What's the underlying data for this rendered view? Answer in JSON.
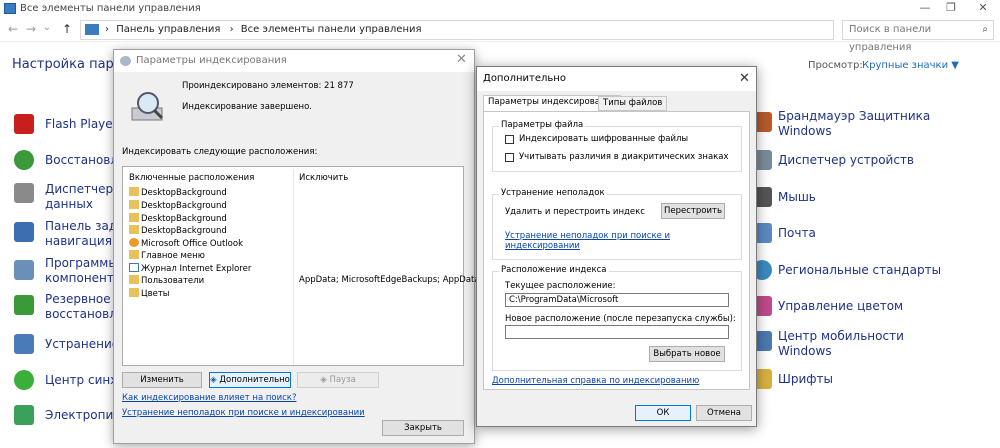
{
  "window": {
    "title": "Все элементы панели управления",
    "minimize": "—",
    "maximize": "❐",
    "close": "✕"
  },
  "address": {
    "back": "←",
    "forward": "→",
    "dropdown": "⌄",
    "up": "↑",
    "breadcrumb_1": "Панель управления",
    "sep_1": "›",
    "sep_2": "›",
    "breadcrumb_2": "Все элементы панели управления",
    "search_placeholder": "Поиск в панели управления"
  },
  "main": {
    "heading": "Настройка парамет",
    "view_label": "Просмотр:",
    "view_value": "Крупные значки ▼",
    "left_items": [
      {
        "label1": "Flash Player (",
        "label2": ""
      },
      {
        "label1": "Восстановлен",
        "label2": ""
      },
      {
        "label1": "Диспетчер у",
        "label2": "данных"
      },
      {
        "label1": "Панель задач",
        "label2": "навигация"
      },
      {
        "label1": "Программы",
        "label2": "компоненты"
      },
      {
        "label1": "Резервное ко",
        "label2": "восстановлен"
      },
      {
        "label1": "Устранение н",
        "label2": ""
      },
      {
        "label1": "Центр синхро",
        "label2": ""
      },
      {
        "label1": "Электропита",
        "label2": ""
      }
    ],
    "right_items": [
      {
        "label1": "Брандмауэр Защитника",
        "label2": "Windows"
      },
      {
        "label1": "Диспетчер устройств",
        "label2": ""
      },
      {
        "label1": "Мышь",
        "label2": ""
      },
      {
        "label1": "Почта",
        "label2": ""
      },
      {
        "label1": "Региональные стандарты",
        "label2": ""
      },
      {
        "label1": "Управление цветом",
        "label2": ""
      },
      {
        "label1": "Центр мобильности",
        "label2": "Windows"
      },
      {
        "label1": "Шрифты",
        "label2": ""
      }
    ]
  },
  "indexing": {
    "title": "Параметры индексирования",
    "close": "✕",
    "indexed_count": "Проиндексировано элементов: 21 877",
    "status": "Индексирование завершено.",
    "locations_label": "Индексировать следующие расположения:",
    "col_included": "Включенные расположения",
    "col_exclude": "Исключить",
    "rows": [
      {
        "name": "DesktopBackground",
        "exclude": ""
      },
      {
        "name": "DesktopBackground",
        "exclude": ""
      },
      {
        "name": "DesktopBackground",
        "exclude": ""
      },
      {
        "name": "DesktopBackground",
        "exclude": ""
      },
      {
        "name": "Microsoft Office Outlook",
        "exclude": ""
      },
      {
        "name": "Главное меню",
        "exclude": ""
      },
      {
        "name": "Журнал Internet Explorer",
        "exclude": ""
      },
      {
        "name": "Пользователи",
        "exclude": "AppData; MicrosoftEdgeBackups; AppData"
      },
      {
        "name": "Цветы",
        "exclude": ""
      }
    ],
    "btn_modify": "Изменить",
    "btn_advanced": "Дополнительно",
    "btn_pause": "Пауза",
    "link_how": "Как индексирование влияет на поиск?",
    "link_troubleshoot": "Устранение неполадок при поиске и индексировании",
    "btn_close": "Закрыть"
  },
  "advanced": {
    "title": "Дополнительно",
    "close": "✕",
    "tab_indexing": "Параметры индексирования",
    "tab_filetypes": "Типы файлов",
    "grp_file": "Параметры файла",
    "chk_encrypted": "Индексировать шифрованные файлы",
    "chk_diacritics": "Учитывать различия в диакритических знаках",
    "grp_troubleshoot": "Устранение неполадок",
    "rebuild_label": "Удалить и перестроить индекс",
    "btn_rebuild": "Перестроить",
    "link_troubleshoot_1": "Устранение неполадок при поиске и",
    "link_troubleshoot_2": "индексировании",
    "grp_location": "Расположение индекса",
    "current_label": "Текущее расположение:",
    "current_value": "C:\\ProgramData\\Microsoft",
    "new_label": "Новое расположение (после перезапуска службы):",
    "new_value": "",
    "btn_select": "Выбрать новое",
    "link_help": "Дополнительная справка по индексированию",
    "btn_ok": "ОК",
    "btn_cancel": "Отмена"
  }
}
